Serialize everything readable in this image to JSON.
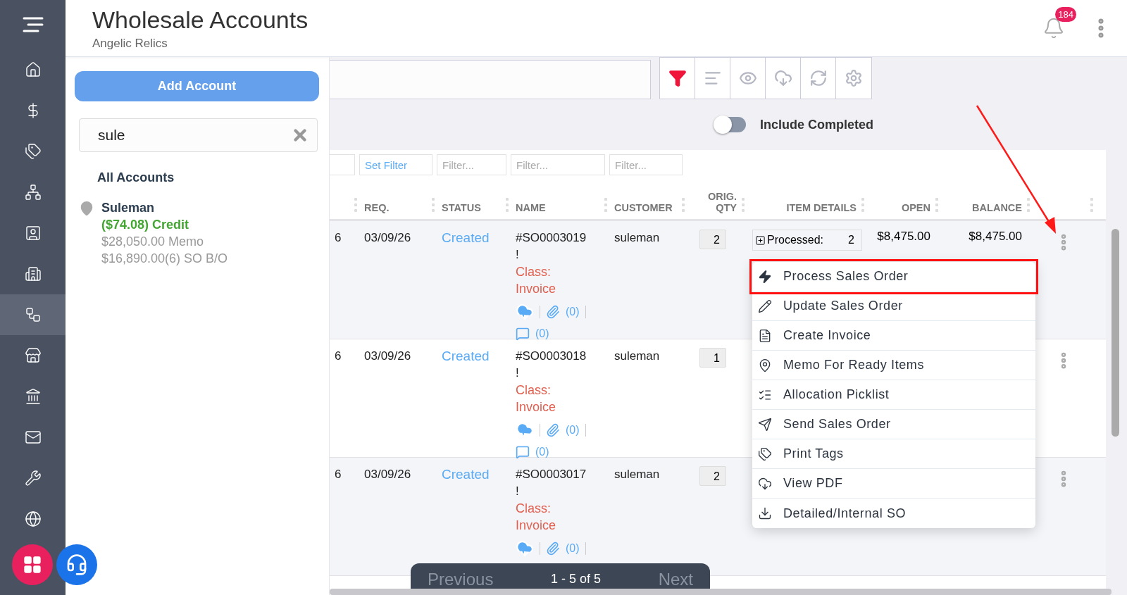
{
  "header": {
    "title": "Wholesale Accounts",
    "subtitle": "Angelic Relics",
    "notification_count": "184"
  },
  "nav": [
    {
      "selected": false
    },
    {
      "selected": false
    },
    {
      "selected": false
    },
    {
      "selected": false
    },
    {
      "selected": false
    },
    {
      "selected": false
    },
    {
      "selected": true
    },
    {
      "selected": false
    },
    {
      "selected": false
    },
    {
      "selected": false
    },
    {
      "selected": false
    },
    {
      "selected": false
    }
  ],
  "accounts_panel": {
    "add_button": "Add Account",
    "search": {
      "value": "sule"
    },
    "section_title": "All Accounts",
    "account": {
      "name": "Suleman",
      "credit": "($74.08) Credit",
      "memo": "$28,050.00 Memo",
      "backorder": "$16,890.00(6) SO B/O"
    }
  },
  "toolbar": [
    {
      "active": true
    },
    {
      "active": false
    },
    {
      "active": false
    },
    {
      "active": false
    },
    {
      "active": false
    },
    {
      "active": false
    }
  ],
  "include_completed": {
    "label": "Include Completed",
    "on": false
  },
  "table": {
    "filters": [
      {
        "text": "Set Filter",
        "kind": "value"
      },
      {
        "text": "Filter...",
        "kind": "placeholder"
      },
      {
        "text": "Filter...",
        "kind": "placeholder"
      },
      {
        "text": "Filter...",
        "kind": "placeholder"
      }
    ],
    "columns": [
      "REQ.",
      "STATUS",
      "NAME",
      "CUSTOMER",
      "ORIG. QTY",
      "ITEM DETAILS",
      "OPEN",
      "BALANCE"
    ],
    "rows": [
      {
        "column_1": "6",
        "req": "03/09/26",
        "status": "Created",
        "name": "#SO0003019",
        "flag": "!",
        "class": "Class: Invoice",
        "attachments": "(0)",
        "comments": "(0)",
        "customer": "suleman",
        "orig_qty": "2",
        "item_details": {
          "label": "Processed:",
          "qty": "2"
        },
        "open": "$8,475.00",
        "balance": "$8,475.00"
      },
      {
        "column_1": "6",
        "req": "03/09/26",
        "status": "Created",
        "name": "#SO0003018",
        "flag": "!",
        "class": "Class: Invoice",
        "attachments": "(0)",
        "comments": "(0)",
        "customer": "suleman",
        "orig_qty": "1"
      },
      {
        "column_1": "6",
        "req": "03/09/26",
        "status": "Created",
        "name": "#SO0003017",
        "flag": "!",
        "class": "Class: Invoice",
        "attachments": "(0)",
        "customer": "suleman",
        "orig_qty": "2"
      }
    ]
  },
  "row_menu": [
    {
      "label": "Process Sales Order",
      "selected": true
    },
    {
      "label": "Update Sales Order",
      "selected": false
    },
    {
      "label": "Create Invoice",
      "selected": false
    },
    {
      "label": "Memo For Ready Items",
      "selected": false
    },
    {
      "label": "Allocation Picklist",
      "selected": false
    },
    {
      "label": "Send Sales Order",
      "selected": false
    },
    {
      "label": "Print Tags",
      "selected": false
    },
    {
      "label": "View PDF",
      "selected": false
    },
    {
      "label": "Detailed/Internal SO",
      "selected": false
    }
  ],
  "pagination": {
    "previous": "Previous",
    "range": "1 - 5 of 5",
    "next": "Next"
  }
}
